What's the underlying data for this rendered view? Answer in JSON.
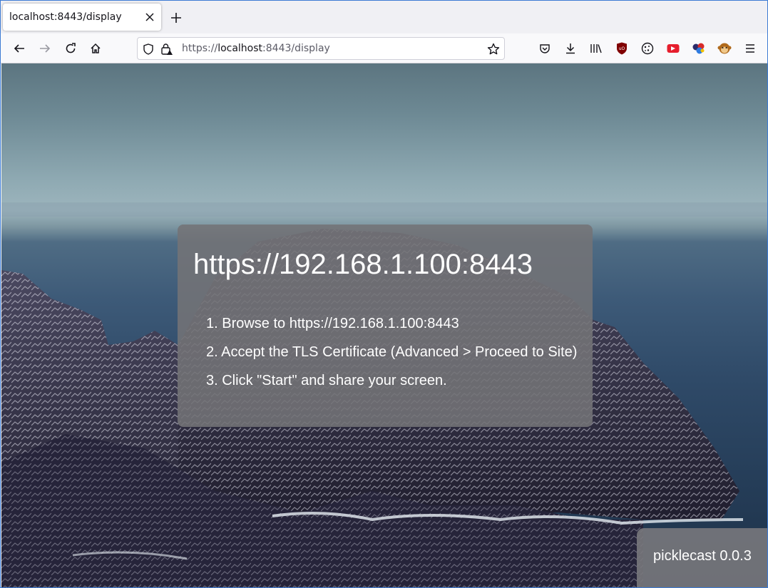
{
  "browser": {
    "tab": {
      "title": "localhost:8443/display"
    },
    "urlbar": {
      "scheme": "https://",
      "host": "localhost",
      "rest": ":8443/display"
    }
  },
  "page": {
    "heading_url": "https://192.168.1.100:8443",
    "steps": [
      "1. Browse to https://192.168.1.100:8443",
      "2. Accept the TLS Certificate (Advanced > Proceed to Site)",
      "3. Click \"Start\" and share your screen."
    ],
    "version": "picklecast 0.0.3"
  },
  "colors": {
    "window_border": "#3d7bd4",
    "card_bg": "#737376",
    "text": "#ffffff"
  }
}
